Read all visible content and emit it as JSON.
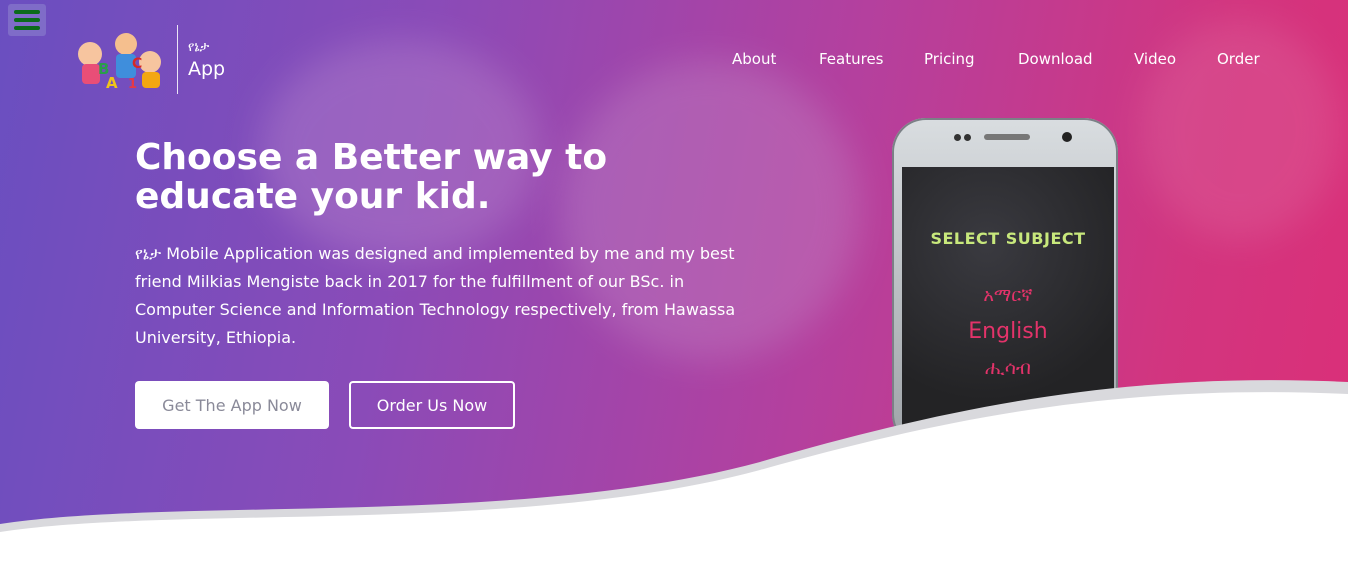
{
  "brand": {
    "name_amharic": "የኔታ",
    "name": "App",
    "logo_text": "ABC 123"
  },
  "nav": {
    "items": [
      "About",
      "Features",
      "Pricing",
      "Download",
      "Video",
      "Order"
    ]
  },
  "hero": {
    "title": "Choose a Better way to educate your kid.",
    "description": "የኔታ Mobile Application was designed and implemented by me and my best friend Milkias Mengiste back in 2017 for the fulfillment of our BSc. in Computer Science and Information Technology respectively, from Hawassa University, Ethiopia.",
    "primary_button": "Get The App Now",
    "secondary_button": "Order Us Now"
  },
  "phone_screen": {
    "title": "SELECT SUBJECT",
    "items": [
      "አማርኛ",
      "English",
      "ሒሳብ"
    ]
  },
  "colors": {
    "gradient_start": "#6a4fc0",
    "gradient_end": "#db2f78",
    "menu_icon": "#0b6b1b",
    "screen_title": "#c8e87c",
    "screen_item": "#e3336a"
  }
}
